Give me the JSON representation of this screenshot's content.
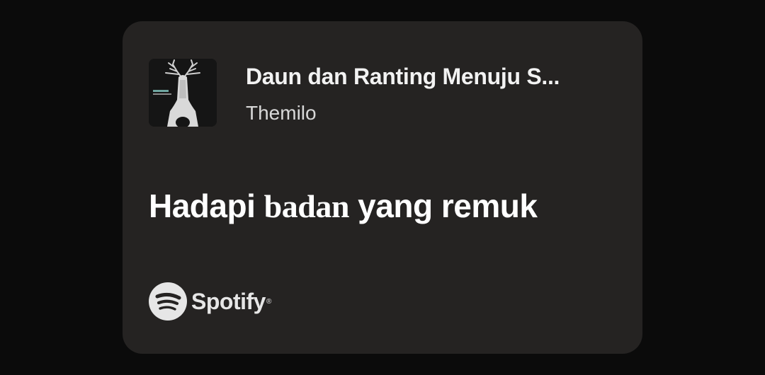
{
  "track": {
    "title": "Daun dan Ranting Menuju S...",
    "artist": "Themilo",
    "album_art_icon": "album-cover-antler-figure"
  },
  "lyric": {
    "part1": "Hadapi ",
    "part2": "badan",
    "part3": " yang remuk"
  },
  "brand": {
    "name": "Spotify",
    "registered_mark": "®",
    "icon": "spotify-icon"
  },
  "colors": {
    "background": "#0b0b0b",
    "card": "#252322",
    "text_primary": "#ffffff",
    "text_secondary": "#d8d8d8"
  }
}
